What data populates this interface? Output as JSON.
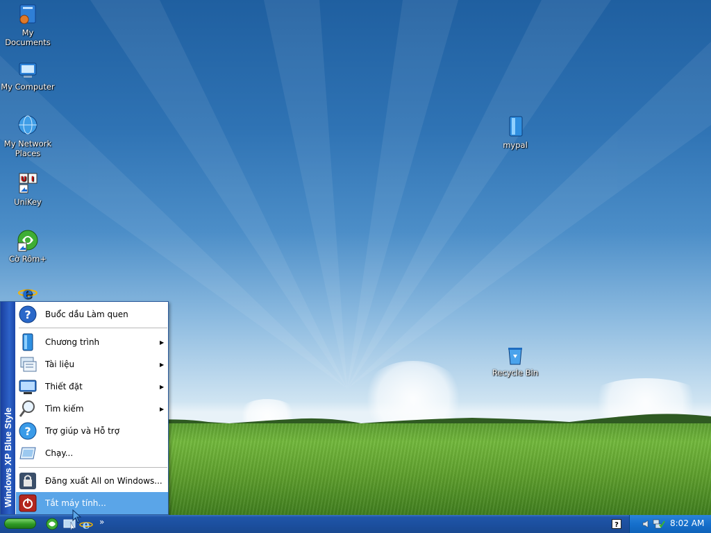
{
  "desktop": {
    "icons": [
      {
        "label_line1": "My",
        "label_line2": "Documents",
        "icon": "my-documents-icon"
      },
      {
        "label_line1": "My Computer",
        "label_line2": "",
        "icon": "my-computer-icon"
      },
      {
        "label_line1": "My Network",
        "label_line2": "Places",
        "icon": "network-places-icon"
      },
      {
        "label_line1": "UniKey",
        "label_line2": "",
        "icon": "unikey-icon"
      },
      {
        "label_line1": "Cờ Rôm+",
        "label_line2": "",
        "icon": "co-rom-icon"
      },
      {
        "label_line1": "mypal",
        "label_line2": "",
        "icon": "mypal-icon"
      },
      {
        "label_line1": "Recycle Bin",
        "label_line2": "",
        "icon": "recycle-bin-icon"
      }
    ]
  },
  "start_menu": {
    "band_text": "Windows XP Blue Style",
    "items": [
      {
        "label": "Buổ́c dầ̀u Làm quen",
        "icon": "help-icon",
        "submenu": false
      },
      {
        "label": "Chương trình",
        "icon": "programs-icon",
        "submenu": true
      },
      {
        "label": "Tài liệu",
        "icon": "documents-icon",
        "submenu": true
      },
      {
        "label": "Thiết đặt",
        "icon": "settings-icon",
        "submenu": true
      },
      {
        "label": "Tìm kiếm",
        "icon": "search-icon",
        "submenu": true
      },
      {
        "label": "Trợ giúp và Hỗ trợ",
        "icon": "help-support-icon",
        "submenu": false
      },
      {
        "label": "Chạy...",
        "icon": "run-icon",
        "submenu": false
      },
      {
        "label": "Đăng xuất All on Windows...",
        "icon": "lock-icon",
        "submenu": false
      },
      {
        "label": "Tắt máy tính...",
        "icon": "power-icon",
        "submenu": false,
        "highlighted": true
      }
    ]
  },
  "taskbar": {
    "quicklaunch": [
      "co-rom-icon",
      "show-desktop-icon",
      "internet-explorer-icon"
    ],
    "chevron": "»",
    "clock": "8:02 AM"
  },
  "colors": {
    "taskbar": "#1b4e9d",
    "menu_highlight": "#5aa5e8",
    "menu_band": "#2d63c9"
  }
}
